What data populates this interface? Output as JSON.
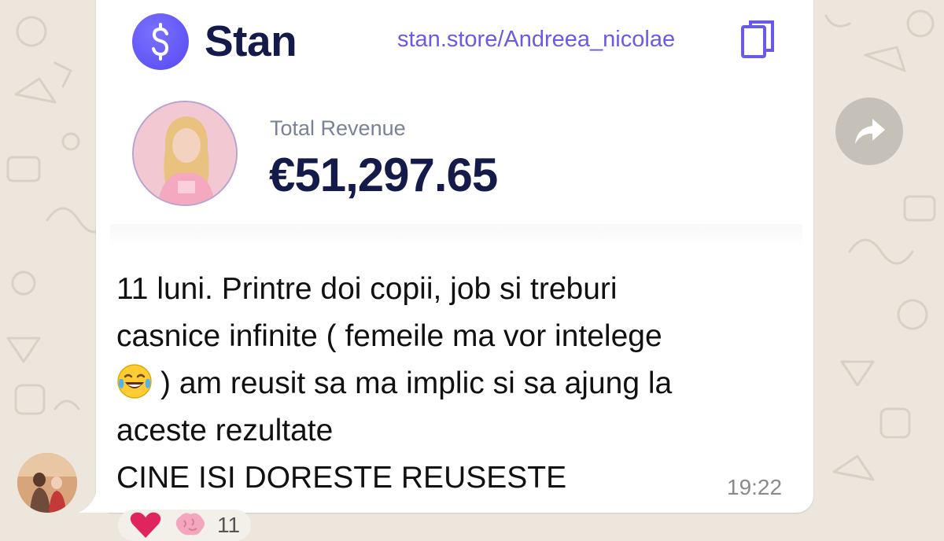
{
  "stan": {
    "brand_name": "Stan",
    "store_url": "stan.store/Andreea_nicolae",
    "revenue_label": "Total Revenue",
    "revenue_value": "€51,297.65"
  },
  "message": {
    "lines": [
      "11 luni. Printre doi copii, job si treburi",
      "casnice infinite ( femeile ma vor intelege",
      ") am reusit sa ma implic si sa ajung la",
      "aceste rezultate",
      "CINE ISI DORESTE REUSESTE"
    ],
    "inline_emoji": "face-with-tears-of-joy-icon",
    "time": "19:22"
  },
  "reactions": {
    "icons": [
      "heart-icon",
      "brain-icon"
    ],
    "count": "11"
  },
  "colors": {
    "brand_purple": "#5648f2",
    "url_purple": "#6a5ae8",
    "revenue_navy": "#141a4a",
    "chat_background": "#ece6dc"
  }
}
